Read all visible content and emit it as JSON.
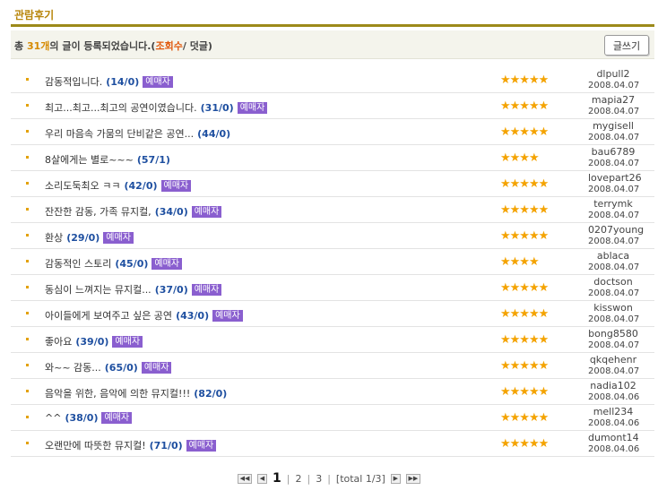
{
  "section": {
    "title": "관람후기"
  },
  "summary": {
    "prefix": "총 ",
    "count": "31개",
    "middle": "의 글이 등록되었습니다.(",
    "views_label": "조회수",
    "suffix": "/ 덧글)",
    "write_button": "글쓰기"
  },
  "colors": {
    "accent": "#9c8a1a",
    "star": "#f4a300",
    "badge": "#8a5fcf",
    "count": "#1e4fa0"
  },
  "reviews": [
    {
      "title": "감동적입니다.",
      "count": "(14/0)",
      "badge": "예매자",
      "stars": "★★★★★",
      "rating": 5,
      "author": "dlpull2",
      "date": "2008.04.07"
    },
    {
      "title": "최고...최고...최고의 공연이였습니다.",
      "count": "(31/0)",
      "badge": "예매자",
      "stars": "★★★★★",
      "rating": 5,
      "author": "mapia27",
      "date": "2008.04.07"
    },
    {
      "title": "우리 마음속 가뭄의 단비같은 공연...",
      "count": "(44/0)",
      "badge": "",
      "stars": "★★★★★",
      "rating": 5,
      "author": "mygisell",
      "date": "2008.04.07"
    },
    {
      "title": "8살에게는 별로~~~",
      "count": "(57/1)",
      "badge": "",
      "stars": "★★★★",
      "rating": 4,
      "author": "bau6789",
      "date": "2008.04.07"
    },
    {
      "title": "소리도둑최오 ㅋㅋ",
      "count": "(42/0)",
      "badge": "예매자",
      "stars": "★★★★★",
      "rating": 5,
      "author": "lovepart26",
      "date": "2008.04.07"
    },
    {
      "title": "잔잔한 감동, 가족 뮤지컬,",
      "count": "(34/0)",
      "badge": "예매자",
      "stars": "★★★★★",
      "rating": 5,
      "author": "terrymk",
      "date": "2008.04.07"
    },
    {
      "title": "환상",
      "count": "(29/0)",
      "badge": "예매자",
      "stars": "★★★★★",
      "rating": 5,
      "author": "0207young",
      "date": "2008.04.07"
    },
    {
      "title": "감동적인 스토리",
      "count": "(45/0)",
      "badge": "예매자",
      "stars": "★★★★",
      "rating": 4,
      "author": "ablaca",
      "date": "2008.04.07"
    },
    {
      "title": "동심이 느껴지는 뮤지컬...",
      "count": "(37/0)",
      "badge": "예매자",
      "stars": "★★★★★",
      "rating": 5,
      "author": "doctson",
      "date": "2008.04.07"
    },
    {
      "title": "아이들에게 보여주고 싶은 공연",
      "count": "(43/0)",
      "badge": "예매자",
      "stars": "★★★★★",
      "rating": 5,
      "author": "kisswon",
      "date": "2008.04.07"
    },
    {
      "title": "좋아요",
      "count": "(39/0)",
      "badge": "예매자",
      "stars": "★★★★★",
      "rating": 5,
      "author": "bong8580",
      "date": "2008.04.07"
    },
    {
      "title": "와~~ 감동...",
      "count": "(65/0)",
      "badge": "예매자",
      "stars": "★★★★★",
      "rating": 5,
      "author": "qkqehenr",
      "date": "2008.04.07"
    },
    {
      "title": "음악을 위한, 음악에 의한 뮤지컬!!!",
      "count": "(82/0)",
      "badge": "",
      "stars": "★★★★★",
      "rating": 5,
      "author": "nadia102",
      "date": "2008.04.06"
    },
    {
      "title": "^^",
      "count": "(38/0)",
      "badge": "예매자",
      "stars": "★★★★★",
      "rating": 5,
      "author": "mell234",
      "date": "2008.04.06"
    },
    {
      "title": "오랜만에 따뜻한 뮤지컬!",
      "count": "(71/0)",
      "badge": "예매자",
      "stars": "★★★★★",
      "rating": 5,
      "author": "dumont14",
      "date": "2008.04.06"
    }
  ],
  "pagination": {
    "first": "◀◀",
    "prev": "◀",
    "current": "1",
    "pages": [
      "2",
      "3"
    ],
    "total": "[total 1/3]",
    "next": "▶",
    "last": "▶▶"
  }
}
